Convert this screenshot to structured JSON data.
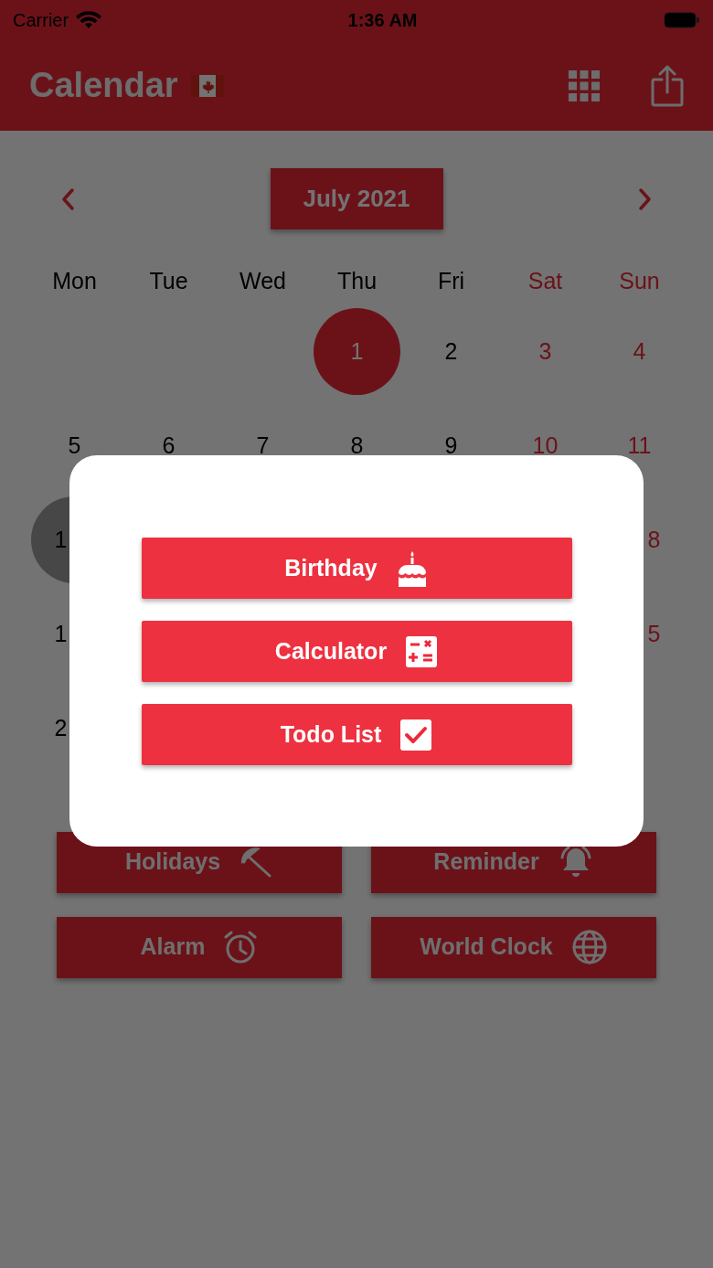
{
  "status_bar": {
    "carrier": "Carrier",
    "time": "1:36 AM"
  },
  "app_bar": {
    "title": "Calendar"
  },
  "calendar": {
    "month": "July 2021",
    "weekdays": [
      {
        "label": "Mon",
        "weekend": false
      },
      {
        "label": "Tue",
        "weekend": false
      },
      {
        "label": "Wed",
        "weekend": false
      },
      {
        "label": "Thu",
        "weekend": false
      },
      {
        "label": "Fri",
        "weekend": false
      },
      {
        "label": "Sat",
        "weekend": true
      },
      {
        "label": "Sun",
        "weekend": true
      }
    ],
    "weeks": [
      [
        {
          "kind": "empty"
        },
        {
          "kind": "empty"
        },
        {
          "kind": "empty"
        },
        {
          "kind": "day",
          "text": "1",
          "weekend": false,
          "selected": true,
          "today": false
        },
        {
          "kind": "day",
          "text": "2",
          "weekend": false,
          "selected": false,
          "today": false
        },
        {
          "kind": "day",
          "text": "3",
          "weekend": true,
          "selected": false,
          "today": false
        },
        {
          "kind": "day",
          "text": "4",
          "weekend": true,
          "selected": false,
          "today": false
        }
      ],
      [
        {
          "kind": "day",
          "text": "5",
          "weekend": false,
          "selected": false,
          "today": false
        },
        {
          "kind": "day",
          "text": "6",
          "weekend": false,
          "selected": false,
          "today": false
        },
        {
          "kind": "day",
          "text": "7",
          "weekend": false,
          "selected": false,
          "today": false
        },
        {
          "kind": "day",
          "text": "8",
          "weekend": false,
          "selected": false,
          "today": false
        },
        {
          "kind": "day",
          "text": "9",
          "weekend": false,
          "selected": false,
          "today": false
        },
        {
          "kind": "day",
          "text": "10",
          "weekend": true,
          "selected": false,
          "today": false
        },
        {
          "kind": "day",
          "text": "11",
          "weekend": true,
          "selected": false,
          "today": false
        }
      ],
      [
        {
          "kind": "day_head",
          "text": "1",
          "weekend": false,
          "selected": false,
          "today": true
        },
        {
          "kind": "empty"
        },
        {
          "kind": "empty"
        },
        {
          "kind": "empty"
        },
        {
          "kind": "empty"
        },
        {
          "kind": "empty"
        },
        {
          "kind": "day_tail",
          "text": "8",
          "weekend": true,
          "selected": false,
          "today": false
        }
      ],
      [
        {
          "kind": "day_head",
          "text": "1",
          "weekend": false,
          "selected": false,
          "today": false
        },
        {
          "kind": "empty"
        },
        {
          "kind": "empty"
        },
        {
          "kind": "empty"
        },
        {
          "kind": "empty"
        },
        {
          "kind": "empty"
        },
        {
          "kind": "day_tail",
          "text": "5",
          "weekend": true,
          "selected": false,
          "today": false
        }
      ],
      [
        {
          "kind": "day_head",
          "text": "2",
          "weekend": false,
          "selected": false,
          "today": false
        },
        {
          "kind": "empty"
        },
        {
          "kind": "empty"
        },
        {
          "kind": "empty"
        },
        {
          "kind": "empty"
        },
        {
          "kind": "empty"
        },
        {
          "kind": "empty"
        }
      ]
    ]
  },
  "feature_buttons": [
    "Holidays",
    "Reminder",
    "Alarm",
    "World Clock"
  ],
  "dialog": {
    "buttons": [
      "Birthday",
      "Calculator",
      "Todo List"
    ]
  }
}
